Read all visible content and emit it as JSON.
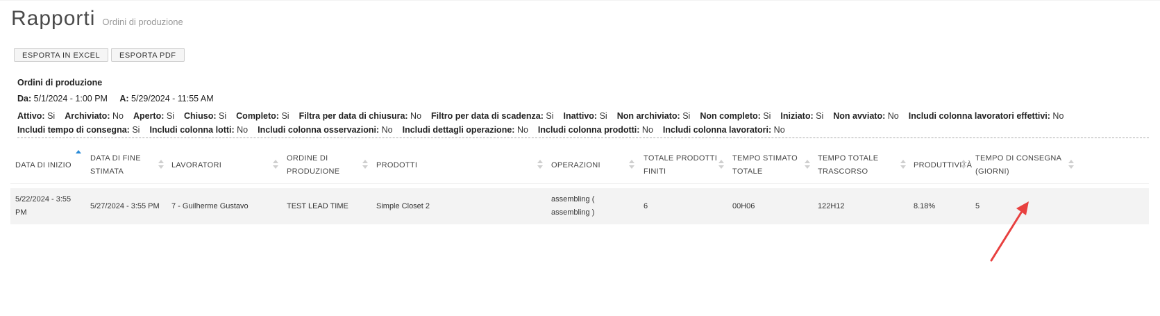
{
  "header": {
    "title": "Rapporti",
    "subtitle": "Ordini di produzione"
  },
  "toolbar": {
    "export_excel": "ESPORTA IN EXCEL",
    "export_pdf": "ESPORTA PDF"
  },
  "report": {
    "title": "Ordini di produzione",
    "from_label": "Da:",
    "from_value": "5/1/2024 - 1:00 PM",
    "to_label": "A:",
    "to_value": "5/29/2024 - 11:55 AM"
  },
  "filters": [
    {
      "label": "Attivo:",
      "value": "Si"
    },
    {
      "label": "Archiviato:",
      "value": "No"
    },
    {
      "label": "Aperto:",
      "value": "Si"
    },
    {
      "label": "Chiuso:",
      "value": "Si"
    },
    {
      "label": "Completo:",
      "value": "Si"
    },
    {
      "label": "Filtra per data di chiusura:",
      "value": "No"
    },
    {
      "label": "Filtro per data di scadenza:",
      "value": "Si"
    },
    {
      "label": "Inattivo:",
      "value": "Si"
    },
    {
      "label": "Non archiviato:",
      "value": "Si"
    },
    {
      "label": "Non completo:",
      "value": "Si"
    },
    {
      "label": "Iniziato:",
      "value": "Si"
    },
    {
      "label": "Non avviato:",
      "value": "No"
    },
    {
      "label": "Includi colonna lavoratori effettivi:",
      "value": "No"
    },
    {
      "label": "Includi tempo di consegna:",
      "value": "Si"
    },
    {
      "label": "Includi colonna lotti:",
      "value": "No"
    },
    {
      "label": "Includi colonna osservazioni:",
      "value": "No"
    },
    {
      "label": "Includi dettagli operazione:",
      "value": "No"
    },
    {
      "label": "Includi colonna prodotti:",
      "value": "No"
    },
    {
      "label": "Includi colonna lavoratori:",
      "value": "No"
    }
  ],
  "table": {
    "columns": [
      {
        "line1": "DATA DI INIZIO",
        "line2": ""
      },
      {
        "line1": "DATA DI FINE",
        "line2": "STIMATA"
      },
      {
        "line1": "LAVORATORI",
        "line2": ""
      },
      {
        "line1": "ORDINE DI",
        "line2": "PRODUZIONE"
      },
      {
        "line1": "PRODOTTI",
        "line2": ""
      },
      {
        "line1": "OPERAZIONI",
        "line2": ""
      },
      {
        "line1": "TOTALE PRODOTTI",
        "line2": "FINITI"
      },
      {
        "line1": "TEMPO STIMATO",
        "line2": "TOTALE"
      },
      {
        "line1": "TEMPO TOTALE",
        "line2": "TRASCORSO"
      },
      {
        "line1": "PRODUTTIVITÀ",
        "line2": ""
      },
      {
        "line1": "TEMPO DI CONSEGNA",
        "line2": "(GIORNI)"
      }
    ],
    "rows": [
      {
        "start_l1": "5/22/2024 - 3:55",
        "start_l2": "PM",
        "end": "5/27/2024 - 3:55 PM",
        "workers": "7 - Guilherme Gustavo",
        "order": "TEST LEAD TIME",
        "product": "Simple Closet 2",
        "op_l1": "assembling (",
        "op_l2": "assembling )",
        "finished": "6",
        "estimated": "00H06",
        "elapsed": "122H12",
        "productivity": "8.18%",
        "lead_time": "5"
      }
    ]
  },
  "colors": {
    "accent_sort": "#2a8bd8",
    "annotation_arrow": "#e8403f"
  }
}
